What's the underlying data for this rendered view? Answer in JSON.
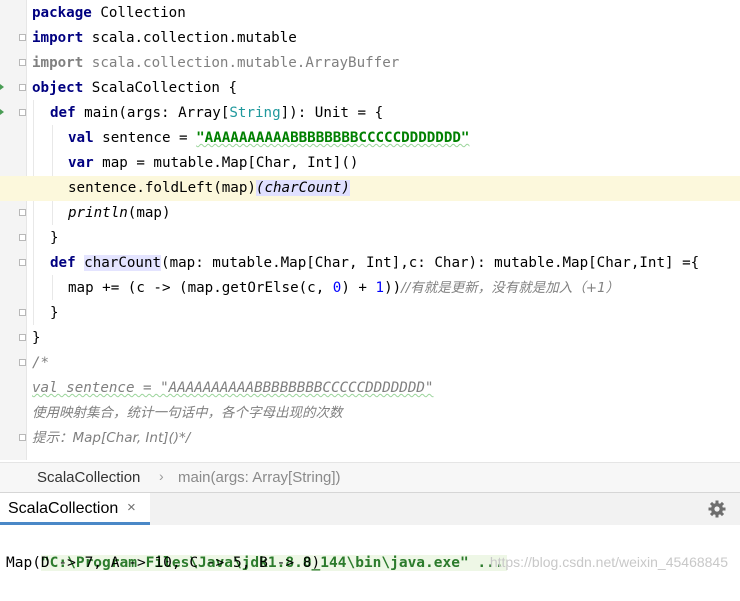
{
  "editor": {
    "lines": {
      "l1": {
        "kw": "package",
        "rest": " Collection"
      },
      "l2": {
        "kw": "import",
        "rest": " scala.collection.mutable"
      },
      "l3": {
        "kw": "import",
        "rest": " scala.collection.mutable.ArrayBuffer"
      },
      "l4": {
        "kw": "object",
        "rest": " ScalaCollection {"
      },
      "l5": {
        "kw": "def",
        "a": " main(args: Array[",
        "type": "String",
        "b": "]): Unit = {"
      },
      "l6": {
        "kw": "val",
        "a": " sentence = ",
        "str": "\"AAAAAAAAAABBBBBBBBCCCCCDDDDDDD\""
      },
      "l7": {
        "kw": "var",
        "a": " map = mutable.Map[Char, Int]()"
      },
      "l8": {
        "a": "sentence.foldLeft(map)",
        "hl": "(charCount)"
      },
      "l9": {
        "fn": "println",
        "a": "(map)"
      },
      "l10": {
        "a": "}"
      },
      "l11": {
        "kw": "def",
        "sp": " ",
        "name": "charCount",
        "a": "(map: mutable.Map[Char, Int],c: Char): mutable.Map[Char,Int] ={"
      },
      "l12": {
        "a": "map += (c -> (map.getOrElse(c, ",
        "n1": "0",
        "b": ") + ",
        "n2": "1",
        "c": "))",
        "cmt": "//有就是更新，没有就是加入（+1）"
      },
      "l13": {
        "a": "}"
      },
      "l14": {
        "a": "}"
      },
      "l15": {
        "cmt": "/*"
      },
      "l16": {
        "cmt": "val sentence = \"AAAAAAAAAABBBBBBBBCCCCCDDDDDDD\""
      },
      "l17": {
        "cmt": "使用映射集合，统计一句话中，各个字母出现的次数"
      },
      "l18": {
        "cmt": "提示：Map[Char, Int]()*/"
      }
    }
  },
  "breadcrumb": {
    "object": "ScalaCollection",
    "separator": "›",
    "method": "main(args: Array[String])"
  },
  "run_panel": {
    "tab_label": "ScalaCollection",
    "close_glyph": "×",
    "settings_icon": "gear-icon"
  },
  "console": {
    "command": "\"C:\\Program Files\\Java\\jdk1.8.0_144\\bin\\java.exe\" ...",
    "output": "Map(D -> 7, A -> 10, C -> 5, B -> 8)",
    "watermark": "https://blog.csdn.net/weixin_45468845"
  },
  "colors": {
    "keyword": "#000080",
    "string": "#008000",
    "type": "#20999d",
    "number": "#0000ff",
    "comment": "#808080",
    "current_line": "#fcf8dc",
    "tab_underline": "#4a88c7"
  }
}
